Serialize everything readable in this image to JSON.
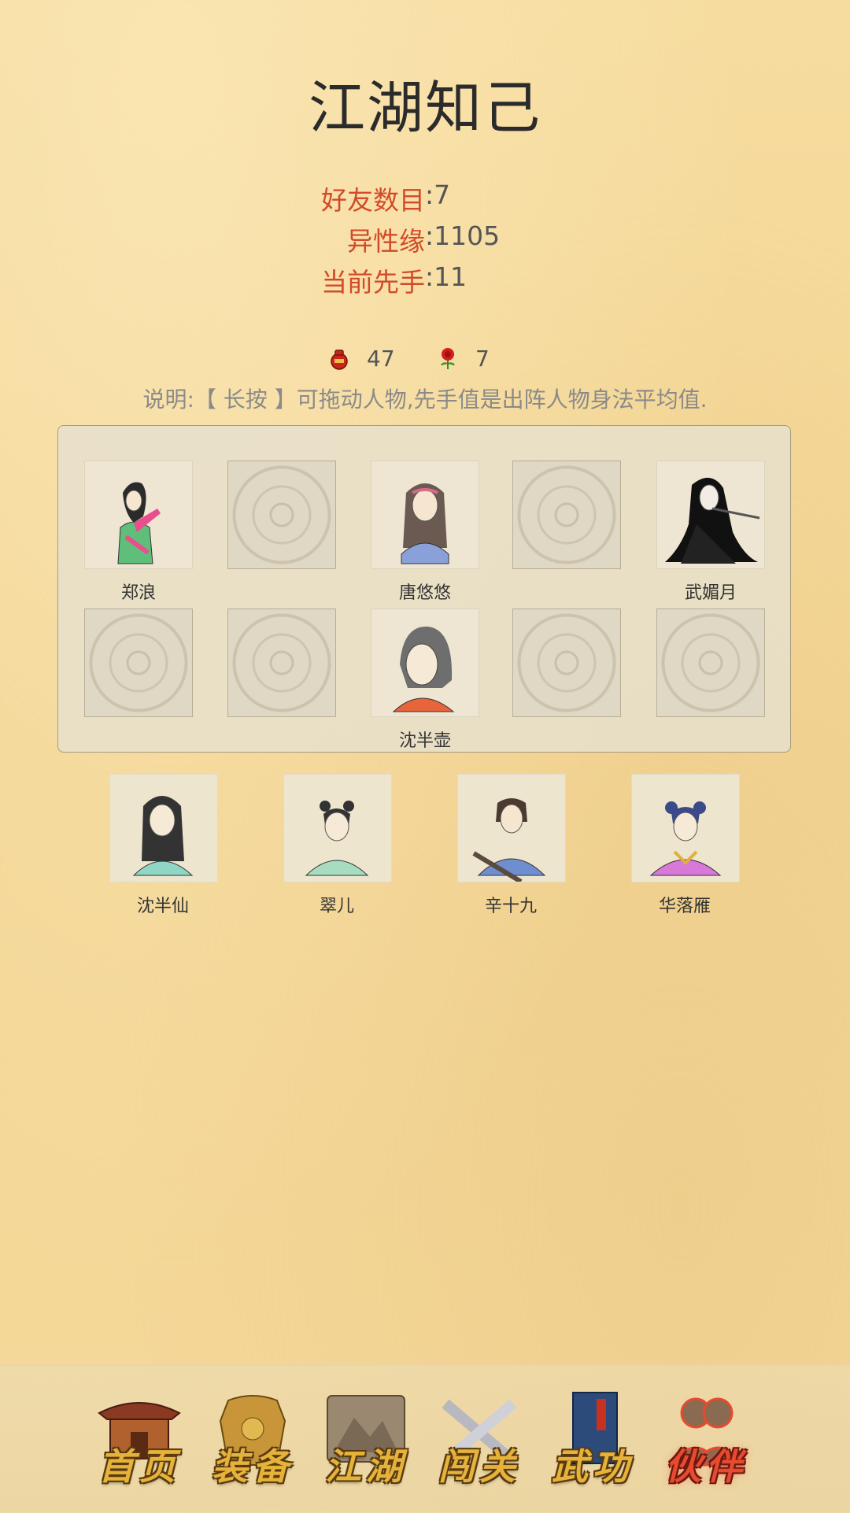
{
  "title": "江湖知己",
  "stats": [
    {
      "label": "好友数目",
      "value": "7"
    },
    {
      "label": "异性缘",
      "value": "1105"
    },
    {
      "label": "当前先手",
      "value": "11"
    }
  ],
  "resources": {
    "gourd": {
      "icon": "gourd-icon",
      "value": "47"
    },
    "rose": {
      "icon": "rose-icon",
      "value": "7"
    }
  },
  "description": "说明:【 长按 】可拖动人物,先手值是出阵人物身法平均值.",
  "formation": {
    "row1": [
      {
        "name": "郑浪",
        "filled": true
      },
      {
        "name": "",
        "filled": false
      },
      {
        "name": "唐悠悠",
        "filled": true
      },
      {
        "name": "",
        "filled": false
      },
      {
        "name": "武媚月",
        "filled": true
      }
    ],
    "row2": [
      {
        "name": "",
        "filled": false
      },
      {
        "name": "",
        "filled": false
      },
      {
        "name": "沈半壶",
        "filled": true
      },
      {
        "name": "",
        "filled": false
      },
      {
        "name": "",
        "filled": false
      }
    ]
  },
  "reserve": [
    {
      "name": "沈半仙"
    },
    {
      "name": "翠儿"
    },
    {
      "name": "辛十九"
    },
    {
      "name": "华落雁"
    }
  ],
  "nav": [
    {
      "label": "首页",
      "active": false
    },
    {
      "label": "装备",
      "active": false
    },
    {
      "label": "江湖",
      "active": false
    },
    {
      "label": "闯关",
      "active": false
    },
    {
      "label": "武功",
      "active": false
    },
    {
      "label": "伙伴",
      "active": true
    }
  ],
  "colors": {
    "stat_label": "#d24a2a",
    "nav_label": "#e5b33a",
    "nav_active": "#e84a2f",
    "background": "#f5d99c"
  }
}
